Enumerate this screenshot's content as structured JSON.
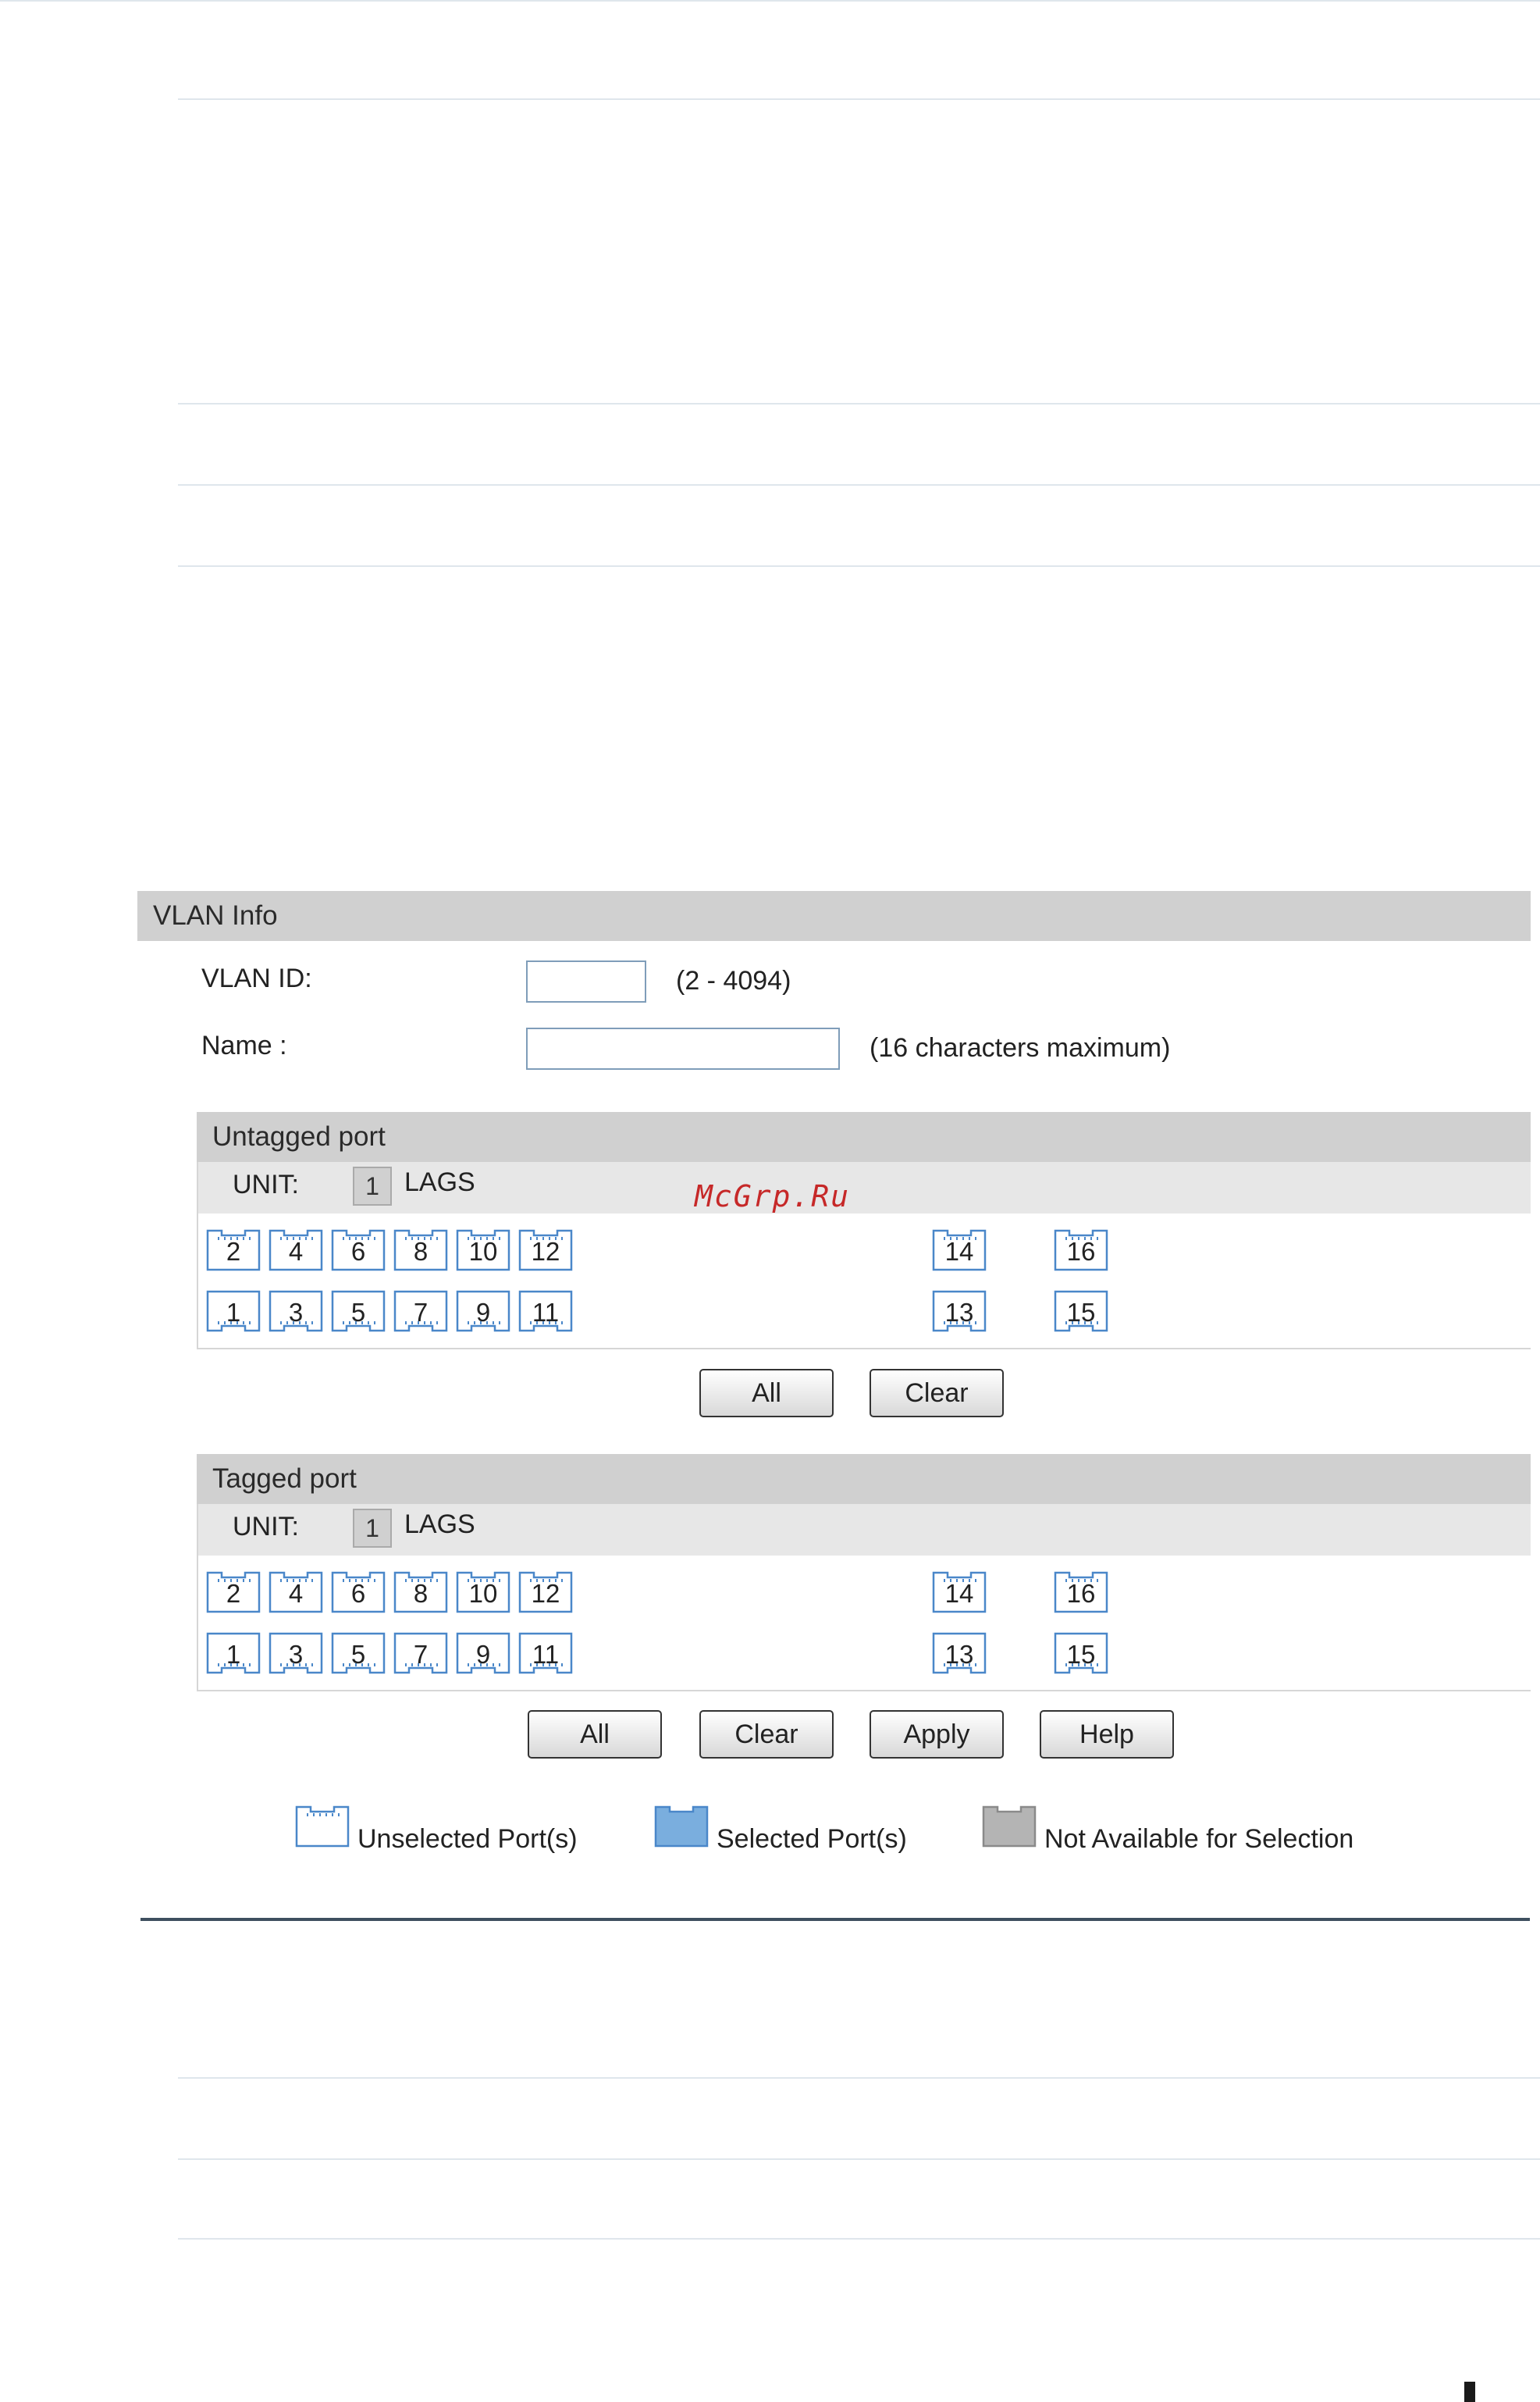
{
  "vlan_info": {
    "title": "VLAN Info",
    "vlan_id_label": "VLAN ID:",
    "vlan_id_value": "",
    "vlan_id_range": "(2 - 4094)",
    "name_label": "Name :",
    "name_value": "",
    "name_hint": "(16 characters maximum)"
  },
  "untagged": {
    "title": "Untagged port",
    "unit_label": "UNIT:",
    "unit_value": "1",
    "lags_label": "LAGS",
    "ports_top": [
      "2",
      "4",
      "6",
      "8",
      "10",
      "12"
    ],
    "ports_bottom": [
      "1",
      "3",
      "5",
      "7",
      "9",
      "11"
    ],
    "sfp_top": [
      "14",
      "16"
    ],
    "sfp_bottom": [
      "13",
      "15"
    ],
    "buttons": {
      "all": "All",
      "clear": "Clear"
    }
  },
  "tagged": {
    "title": "Tagged port",
    "unit_label": "UNIT:",
    "unit_value": "1",
    "lags_label": "LAGS",
    "ports_top": [
      "2",
      "4",
      "6",
      "8",
      "10",
      "12"
    ],
    "ports_bottom": [
      "1",
      "3",
      "5",
      "7",
      "9",
      "11"
    ],
    "sfp_top": [
      "14",
      "16"
    ],
    "sfp_bottom": [
      "13",
      "15"
    ],
    "buttons": {
      "all": "All",
      "clear": "Clear",
      "apply": "Apply",
      "help": "Help"
    }
  },
  "legend": {
    "unselected": "Unselected Port(s)",
    "selected": "Selected Port(s)",
    "unavailable": "Not Available for Selection",
    "colors": {
      "unselected": "#ffffff",
      "selected": "#7aaede",
      "unavailable": "#b4b4b4"
    }
  },
  "watermark": "McGrp.Ru"
}
